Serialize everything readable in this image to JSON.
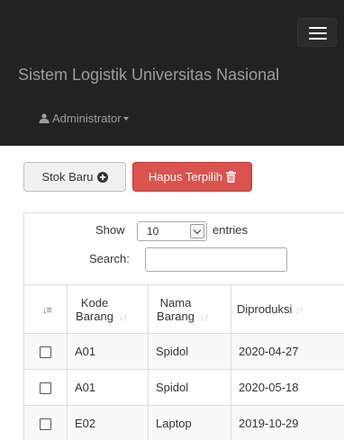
{
  "navbar": {
    "brand": "Sistem Logistik Universitas Nasional",
    "user": "Administrator"
  },
  "actions": {
    "add_stock_label": "Stok Baru",
    "delete_selected_label": "Hapus Terpilih"
  },
  "datatable": {
    "show_label": "Show",
    "entries_value": "10",
    "entries_label": "entries",
    "search_label": "Search:",
    "search_value": "",
    "columns": [
      {
        "label": ""
      },
      {
        "label": "Kode Barang"
      },
      {
        "label": "Nama Barang"
      },
      {
        "label": "Diproduksi"
      }
    ],
    "rows": [
      {
        "kode": "A01",
        "nama": "Spidol",
        "diproduksi": "2020-04-27"
      },
      {
        "kode": "A01",
        "nama": "Spidol",
        "diproduksi": "2020-05-18"
      },
      {
        "kode": "E02",
        "nama": "Laptop",
        "diproduksi": "2019-10-29"
      }
    ]
  },
  "colors": {
    "navbar_bg": "#222222",
    "navbar_text": "#9d9d9d",
    "danger": "#d9534f",
    "default_btn": "#f0f0f0"
  },
  "icons": {
    "menu": "hamburger-icon",
    "user": "user-icon",
    "add": "plus-circle-icon",
    "delete": "trash-icon",
    "sort": "sort-icon"
  }
}
